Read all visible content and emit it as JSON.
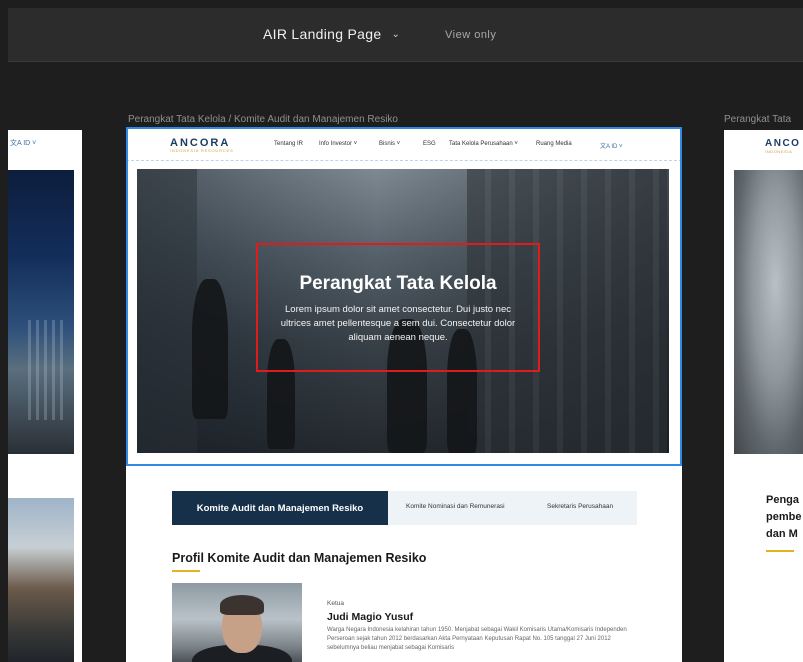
{
  "topbar": {
    "title": "AIR Landing Page",
    "view_mode": "View only"
  },
  "frames": {
    "main_label": "Perangkat Tata Kelola / Komite Audit dan Manajemen Resiko",
    "right_label": "Perangkat Tata"
  },
  "site": {
    "logo": "ANCORA",
    "logo_sub": "INDONESIA RESOURCES",
    "nav": [
      "Tentang IR",
      "Info Investor ˅",
      "Bisnis ˅",
      "ESG",
      "Tata Kelola Perusahaan ˅",
      "Ruang Media"
    ],
    "lang": "文A ID ˅"
  },
  "hero": {
    "title": "Perangkat Tata Kelola",
    "text": "Lorem ipsum dolor sit amet consectetur. Dui justo nec ultrices amet pellentesque a sem dui. Consectetur dolor aliquam aenean neque."
  },
  "tabs": {
    "active": "Komite Audit dan Manajemen Resiko",
    "items": [
      "Komite Nominasi dan Remunerasi",
      "Sekretaris Perusahaan"
    ]
  },
  "profile": {
    "section_title": "Profil Komite Audit dan Manajemen Resiko",
    "role": "Ketua",
    "name": "Judi Magio Yusuf",
    "bio": "Warga Negara Indonesia kelahiran tahun 1950. Menjabat sebagai Wakil Komisaris Utama/Komisaris Independen Perseroan sejak tahun 2012 berdasarkan Akta Pernyataan Keputusan Rapat No. 105 tanggal 27 Juni 2012 sebelumnya beliau menjabat sebagai Komisaris"
  },
  "left_frame": {
    "lang": "文A ID ˅"
  },
  "right_frame": {
    "logo": "ANCO",
    "logo_sub": "INDONESIA",
    "heading_lines": [
      "Penga",
      "pembe",
      "dan M"
    ]
  },
  "colors": {
    "canvas": "#1e1e1e",
    "selection": "#2e8ae6",
    "highlight": "#e11b1b",
    "navy": "#173049",
    "gold": "#e3b21f"
  }
}
